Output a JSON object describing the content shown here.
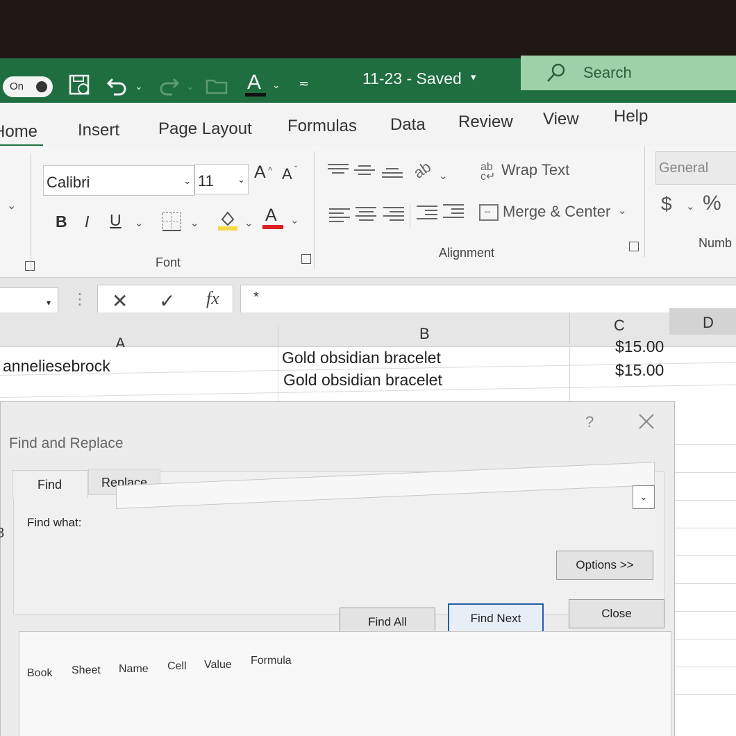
{
  "titlebar": {
    "autosave": "On",
    "doc_title": "11-23  -  Saved",
    "search": "Search",
    "font_color_letter": "A"
  },
  "tabs": [
    "ome",
    "Insert",
    "Page Layout",
    "Formulas",
    "Data",
    "Review",
    "View",
    "Help"
  ],
  "ribbon": {
    "font_name": "Calibri",
    "font_size": "11",
    "grow": "A",
    "shrink": "A",
    "bold": "B",
    "italic": "I",
    "underline": "U",
    "font_color": "A",
    "group_font": "Font",
    "wrap_text": "Wrap Text",
    "merge_center": "Merge & Center",
    "group_alignment": "Alignment",
    "number_format": "General",
    "currency": "$",
    "percent": "%",
    "group_number": "Numb"
  },
  "formula_bar": {
    "cancel": "✕",
    "enter": "✓",
    "fx": "fx",
    "value": "*"
  },
  "grid": {
    "columns": [
      "A",
      "B",
      "C",
      "D"
    ],
    "rows": [
      {
        "a": "anneliesebrock",
        "b": "Gold obsidian bracelet",
        "c": "$15.00"
      },
      {
        "a": "",
        "b": "Gold obsidian bracelet",
        "c": "$15.00"
      }
    ],
    "row_number_fragment": "8"
  },
  "dialog": {
    "title": "Find and Replace",
    "help": "?",
    "tab_find": "Find",
    "tab_replace": "Replace",
    "find_what_label": "Find what:",
    "find_what_value": "",
    "options_button": "Options >>",
    "find_all": "Find All",
    "find_next": "Find Next",
    "close": "Close",
    "results_columns": [
      "Book",
      "Sheet",
      "Name",
      "Cell",
      "Value",
      "Formula"
    ]
  }
}
